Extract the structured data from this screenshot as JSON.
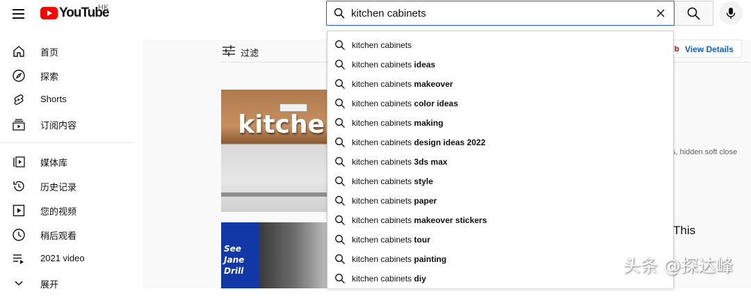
{
  "header": {
    "logo_text": "YouTube",
    "region": "HK",
    "search": {
      "value": "kitchen cabinets",
      "placeholder": ""
    }
  },
  "sidebar": {
    "items": [
      {
        "label": "首页",
        "icon": "home-icon"
      },
      {
        "label": "探索",
        "icon": "explore-icon"
      },
      {
        "label": "Shorts",
        "icon": "shorts-icon"
      },
      {
        "label": "订阅内容",
        "icon": "subscriptions-icon"
      },
      {
        "label": "媒体库",
        "icon": "library-icon"
      },
      {
        "label": "历史记录",
        "icon": "history-icon"
      },
      {
        "label": "您的视频",
        "icon": "your-videos-icon"
      },
      {
        "label": "稍后观看",
        "icon": "watch-later-icon"
      },
      {
        "label": "2021 video",
        "icon": "playlist-icon"
      },
      {
        "label": "展开",
        "icon": "chevron-down-icon"
      }
    ]
  },
  "main": {
    "filter_label": "过滤",
    "thumb1_word": "kitchen",
    "thumb2_lines": [
      "See",
      "Jane",
      "Drill"
    ],
    "view_details": "View Details",
    "view_details_logo": "lb",
    "side_desc": "s, hidden soft close",
    "side_title": "This"
  },
  "suggestions": [
    {
      "prefix": "kitchen cabinets",
      "suffix": ""
    },
    {
      "prefix": "kitchen cabinets",
      "suffix": "ideas"
    },
    {
      "prefix": "kitchen cabinets",
      "suffix": "makeover"
    },
    {
      "prefix": "kitchen cabinets",
      "suffix": "color ideas"
    },
    {
      "prefix": "kitchen cabinets",
      "suffix": "making"
    },
    {
      "prefix": "kitchen cabinets",
      "suffix": "design ideas 2022"
    },
    {
      "prefix": "kitchen cabinets",
      "suffix": "3ds max"
    },
    {
      "prefix": "kitchen cabinets",
      "suffix": "style"
    },
    {
      "prefix": "kitchen cabinets",
      "suffix": "paper"
    },
    {
      "prefix": "kitchen cabinets",
      "suffix": "makeover stickers"
    },
    {
      "prefix": "kitchen cabinets",
      "suffix": "tour"
    },
    {
      "prefix": "kitchen cabinets",
      "suffix": "painting"
    },
    {
      "prefix": "kitchen cabinets",
      "suffix": "diy"
    }
  ],
  "watermark": "头条 @探达峰",
  "colors": {
    "accent": "#1c62b9",
    "brand": "#ff0000",
    "link": "#065fd4"
  }
}
